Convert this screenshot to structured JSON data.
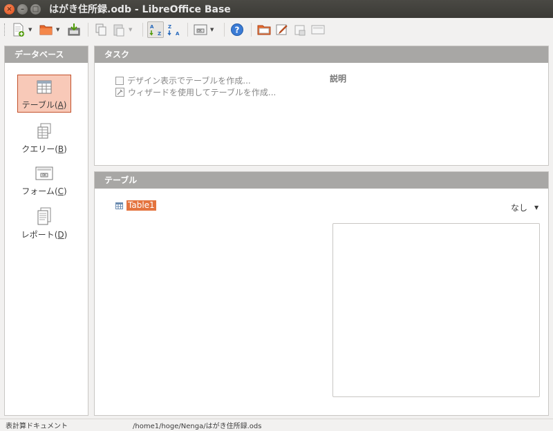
{
  "window": {
    "title": "はがき住所録.odb - LibreOffice Base",
    "close_glyph": "×",
    "min_glyph": "–",
    "max_glyph": "□"
  },
  "toolbar": {
    "icons": [
      "new-document-icon",
      "open-icon",
      "save-icon",
      "copy-icon",
      "paste-icon",
      "sort-ascending-icon",
      "sort-descending-icon",
      "form-icon",
      "help-icon",
      "table-icon",
      "edit-icon",
      "delete-icon",
      "rename-icon"
    ]
  },
  "sidebar": {
    "title": "データベース",
    "items": [
      {
        "label": "テーブル",
        "mnemonic": "A",
        "selected": true
      },
      {
        "label": "クエリー",
        "mnemonic": "B",
        "selected": false
      },
      {
        "label": "フォーム",
        "mnemonic": "C",
        "selected": false
      },
      {
        "label": "レポート",
        "mnemonic": "D",
        "selected": false
      }
    ]
  },
  "tasks": {
    "title": "タスク",
    "items": [
      "デザイン表示でテーブルを作成...",
      "ウィザードを使用してテーブルを作成..."
    ],
    "description_label": "説明"
  },
  "tables": {
    "title": "テーブル",
    "items": [
      "Table1"
    ],
    "preview_option": "なし"
  },
  "status": {
    "doc_type": "表計算ドキュメント",
    "path": "/home1/hoge/Nenga/はがき住所録.ods"
  },
  "colors": {
    "accent": "#e4743f",
    "selection_bg": "#f8c9b8",
    "panel_header": "#a8a7a5"
  }
}
